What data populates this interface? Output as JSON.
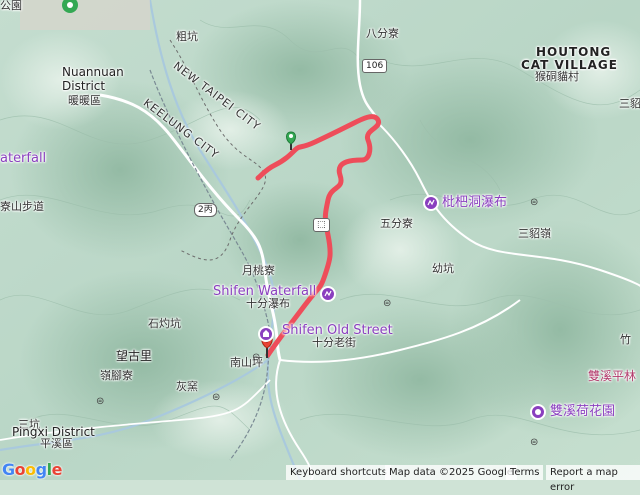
{
  "map": {
    "route_color": "#ee4d5a",
    "start_marker_color": "#34a853",
    "end_marker_color": "#ea4335",
    "poi_color": "#8a3fbf"
  },
  "labels": {
    "nuannuan_en1": "Nuannuan",
    "nuannuan_en2": "District",
    "nuannuan_zh": "暖暖區",
    "new_taipei": "NEW TAIPEI CITY",
    "keelung": "KEELUNG CITY",
    "zhukeng": "粗坑",
    "bafenliao": "八分寮",
    "houtong_en1": "HOUTONG",
    "houtong_en2": "CAT VILLAGE",
    "houtong_zh": "猴硐貓村",
    "sandiaoling": "三貂嶺",
    "wufenliao": "五分寮",
    "sandiaoling2": "三貂嶺",
    "youkeng": "幼坑",
    "yuetaoliao": "月桃寮",
    "shishaokeng": "石灼坑",
    "wangguli": "望古里",
    "lingjiaoliao": "嶺腳寮",
    "nanshanping": "南山坪",
    "huiyao": "灰窯",
    "sankeng": "三坑",
    "pingxi_en": "Pingxi District",
    "pingxi_zh": "平溪區",
    "left_waterfall": "aterfall",
    "left_trail": "寮山步道",
    "left_top": "公園",
    "zhuben": "竹",
    "shuangxi_pinglin": "雙溪平林",
    "shuangxi_lotus": "雙溪荷花園",
    "pipadong": "枇杷洞瀑布",
    "shifen_wf_en": "Shifen Waterfall",
    "shifen_wf_zh": "十分瀑布",
    "shifen_st_en": "Shifen Old Street",
    "shifen_st_zh": "十分老街",
    "route_106": "106",
    "route_2bing": "2丙"
  },
  "attribution": {
    "keyboard": "Keyboard shortcuts",
    "mapdata": "Map data ©2025 Google",
    "terms": "Terms",
    "report": "Report a map error",
    "logo": "Google"
  }
}
